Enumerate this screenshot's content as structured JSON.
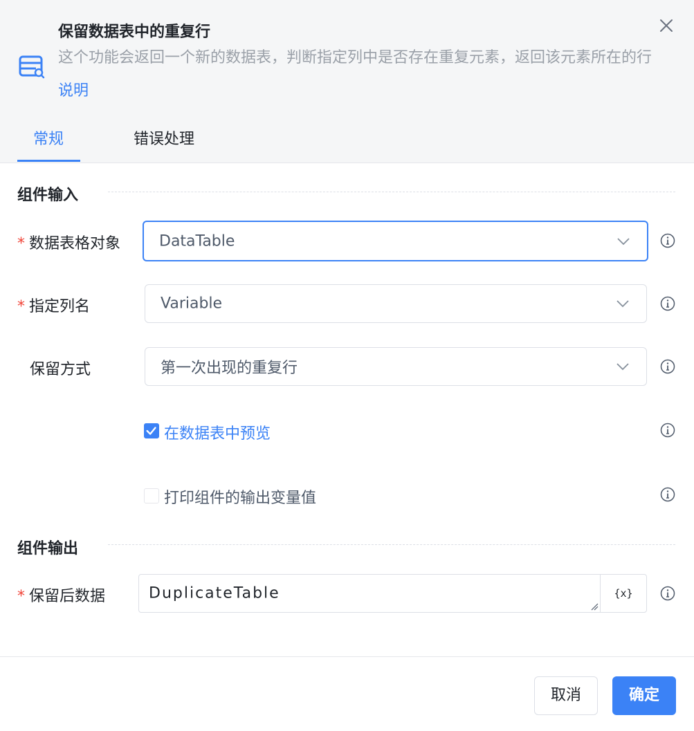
{
  "dialog": {
    "title": "保留数据表中的重复行",
    "description": "这个功能会返回一个新的数据表，判断指定列中是否存在重复元素，返回该元素所在的行",
    "help_link": "说明"
  },
  "tabs": [
    {
      "label": "常规",
      "active": true
    },
    {
      "label": "错误处理",
      "active": false
    }
  ],
  "input_section": {
    "title": "组件输入",
    "fields": [
      {
        "label": "数据表格对象",
        "required": true,
        "value": "DataTable"
      },
      {
        "label": "指定列名",
        "required": true,
        "value": "Variable"
      },
      {
        "label": "保留方式",
        "required": false,
        "value": "第一次出现的重复行"
      }
    ],
    "checkboxes": [
      {
        "label": "在数据表中预览",
        "checked": true
      },
      {
        "label": "打印组件的输出变量值",
        "checked": false
      }
    ]
  },
  "output_section": {
    "title": "组件输出",
    "field": {
      "label": "保留后数据",
      "required": true,
      "value": "DuplicateTable",
      "var_button": "{x}"
    }
  },
  "footer": {
    "cancel_label": "取消",
    "ok_label": "确定"
  },
  "colors": {
    "accent": "#3b82f6",
    "required": "#f04438"
  },
  "icons": [
    "datatable-search-icon",
    "close-icon",
    "chevron-down-icon",
    "info-icon",
    "check-icon",
    "resize-handle-icon"
  ]
}
